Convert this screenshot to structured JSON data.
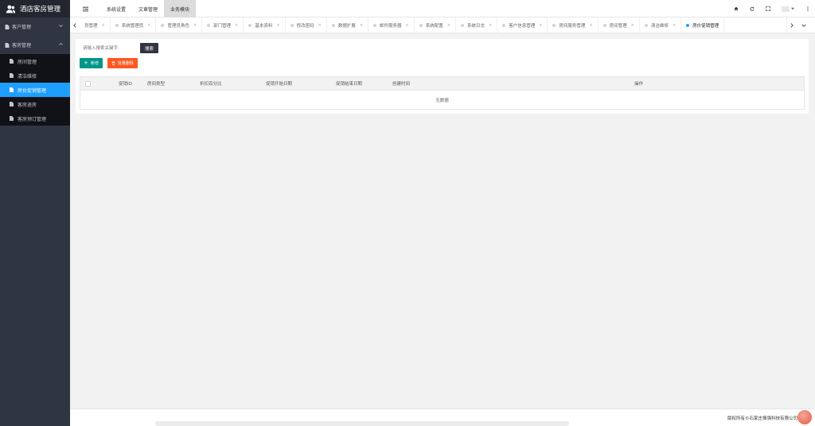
{
  "app": {
    "title": "酒店客房管理"
  },
  "sidebar": {
    "groups": [
      {
        "label": "客户管理",
        "expanded": false
      },
      {
        "label": "客房管理",
        "expanded": true
      }
    ],
    "items": [
      {
        "label": "房间管理",
        "active": false
      },
      {
        "label": "清洁维修",
        "active": false
      },
      {
        "label": "房价促销管理",
        "active": true
      },
      {
        "label": "客房退房",
        "active": false
      },
      {
        "label": "客房预订管理",
        "active": false
      }
    ]
  },
  "header": {
    "nav": [
      "系统设置",
      "文章管理",
      "业务模块"
    ],
    "active_nav": "业务模块"
  },
  "tabs": [
    {
      "label": "员管理",
      "active": false
    },
    {
      "label": "系统管理员",
      "active": false
    },
    {
      "label": "管理员角色",
      "active": false
    },
    {
      "label": "部门管理",
      "active": false
    },
    {
      "label": "基本资料",
      "active": false
    },
    {
      "label": "修改密码",
      "active": false
    },
    {
      "label": "数据扩展",
      "active": false
    },
    {
      "label": "邮件服务器",
      "active": false
    },
    {
      "label": "系统配置",
      "active": false
    },
    {
      "label": "系统日志",
      "active": false
    },
    {
      "label": "客户信息管理",
      "active": false
    },
    {
      "label": "房间服务管理",
      "active": false
    },
    {
      "label": "房间管理",
      "active": false
    },
    {
      "label": "清洁维修",
      "active": false
    },
    {
      "label": "房价促销管理",
      "active": true
    }
  ],
  "search": {
    "placeholder": "请输入搜索关键字",
    "button": "搜索"
  },
  "actions": {
    "add": "新增",
    "batch_delete": "批量删除"
  },
  "table": {
    "columns": [
      "促销ID",
      "房间类型",
      "折扣百分比",
      "促销开始日期",
      "促销结束日期",
      "创建时间",
      "操作"
    ],
    "empty_text": "无数据"
  },
  "footer": {
    "copyright": "版权所有©石家庄振强科技有限公司"
  },
  "colors": {
    "sidebar": "#2f3541",
    "active": "#1e9fff",
    "add": "#009688",
    "delete": "#ff5722"
  }
}
